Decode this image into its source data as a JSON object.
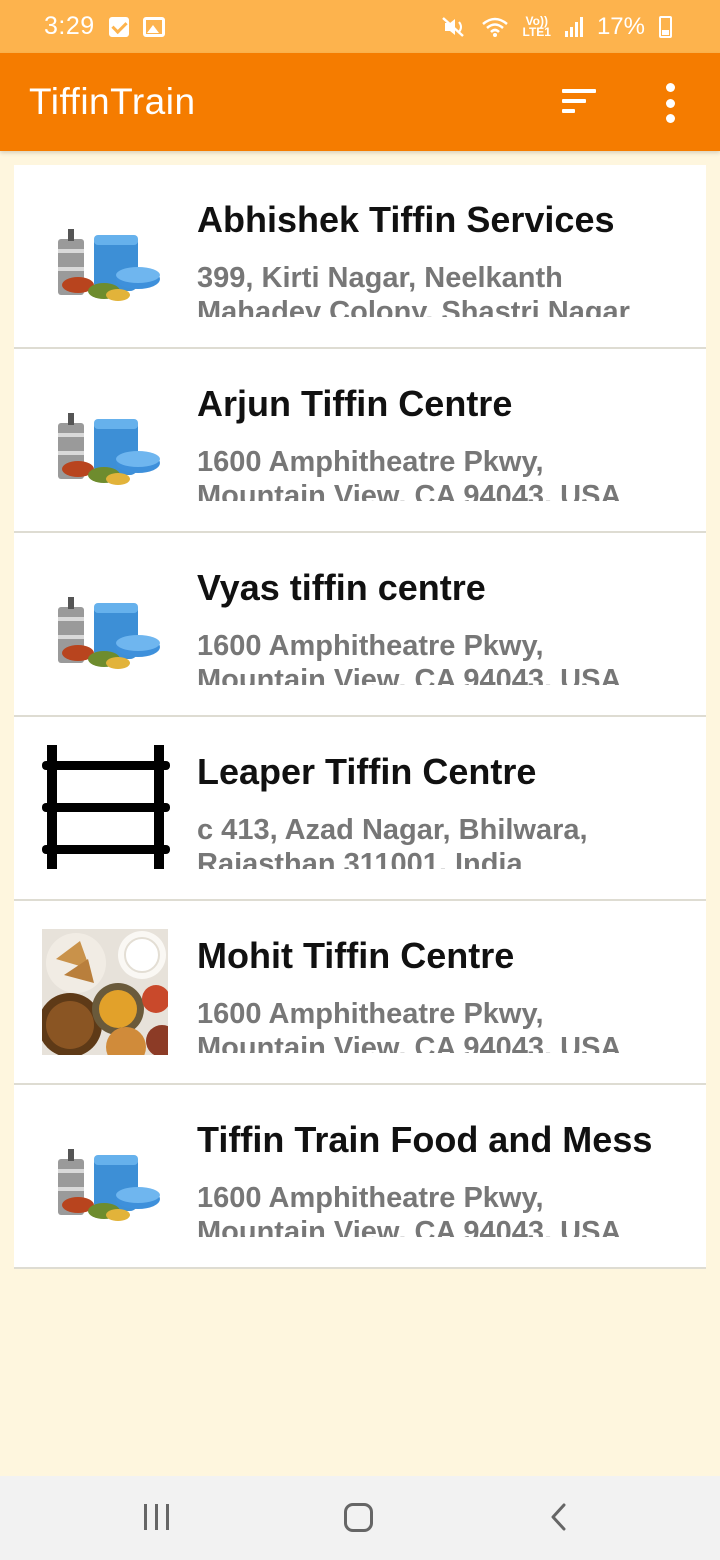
{
  "status_bar": {
    "time": "3:29",
    "lte_top": "Vo))",
    "lte_bottom": "LTE1",
    "battery": "17%"
  },
  "app_bar": {
    "title": "TiffinTrain",
    "sort_icon": "sort-icon",
    "more_icon": "more-vert-icon"
  },
  "colors": {
    "status_bar": "#FDB34D",
    "app_bar": "#F57C00",
    "background": "#FEF6DE",
    "card": "#FFFFFF",
    "address": "#777777"
  },
  "items": [
    {
      "title": "Abhishek Tiffin Services",
      "address": "399, Kirti Nagar, Neelkanth Mahadev Colony, Shastri Nagar",
      "image": "tiffin-box-image"
    },
    {
      "title": "Arjun Tiffin Centre",
      "address": "1600 Amphitheatre Pkwy, Mountain View, CA 94043, USA",
      "image": "tiffin-box-image"
    },
    {
      "title": "Vyas tiffin centre",
      "address": "1600 Amphitheatre Pkwy, Mountain View, CA 94043, USA",
      "image": "tiffin-box-image"
    },
    {
      "title": "Leaper Tiffin Centre",
      "address": "c 413, Azad Nagar, Bhilwara, Rajasthan 311001, India",
      "image": "ladder-image"
    },
    {
      "title": "Mohit Tiffin Centre",
      "address": "1600 Amphitheatre Pkwy, Mountain View, CA 94043, USA",
      "image": "thali-food-image"
    },
    {
      "title": "Tiffin Train Food and Mess",
      "address": "1600 Amphitheatre Pkwy, Mountain View, CA 94043, USA",
      "image": "tiffin-box-image"
    }
  ],
  "nav_bar": {
    "recents_icon": "recents-icon",
    "home_icon": "home-icon",
    "back_icon": "back-icon"
  }
}
